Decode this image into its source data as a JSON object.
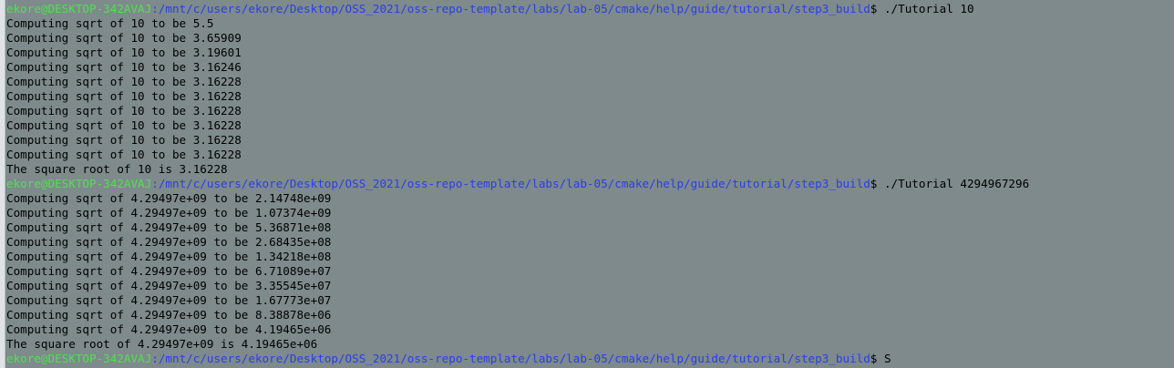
{
  "terminal": {
    "lines": [
      {
        "type": "prompt",
        "user": "ekore@DESKTOP-342AVAJ",
        "path": ":/mnt/c/users/ekore/Desktop/OSS_2021/oss-repo-template/labs/lab-05/cmake/help/guide/tutorial/step3_build",
        "sign": "$ ",
        "cmd": "./Tutorial 10"
      },
      {
        "type": "out",
        "text": "Computing sqrt of 10 to be 5.5"
      },
      {
        "type": "out",
        "text": "Computing sqrt of 10 to be 3.65909"
      },
      {
        "type": "out",
        "text": "Computing sqrt of 10 to be 3.19601"
      },
      {
        "type": "out",
        "text": "Computing sqrt of 10 to be 3.16246"
      },
      {
        "type": "out",
        "text": "Computing sqrt of 10 to be 3.16228"
      },
      {
        "type": "out",
        "text": "Computing sqrt of 10 to be 3.16228"
      },
      {
        "type": "out",
        "text": "Computing sqrt of 10 to be 3.16228"
      },
      {
        "type": "out",
        "text": "Computing sqrt of 10 to be 3.16228"
      },
      {
        "type": "out",
        "text": "Computing sqrt of 10 to be 3.16228"
      },
      {
        "type": "out",
        "text": "Computing sqrt of 10 to be 3.16228"
      },
      {
        "type": "out",
        "text": "The square root of 10 is 3.16228"
      },
      {
        "type": "prompt",
        "user": "ekore@DESKTOP-342AVAJ",
        "path": ":/mnt/c/users/ekore/Desktop/OSS_2021/oss-repo-template/labs/lab-05/cmake/help/guide/tutorial/step3_build",
        "sign": "$ ",
        "cmd": "./Tutorial 4294967296"
      },
      {
        "type": "out",
        "text": "Computing sqrt of 4.29497e+09 to be 2.14748e+09"
      },
      {
        "type": "out",
        "text": "Computing sqrt of 4.29497e+09 to be 1.07374e+09"
      },
      {
        "type": "out",
        "text": "Computing sqrt of 4.29497e+09 to be 5.36871e+08"
      },
      {
        "type": "out",
        "text": "Computing sqrt of 4.29497e+09 to be 2.68435e+08"
      },
      {
        "type": "out",
        "text": "Computing sqrt of 4.29497e+09 to be 1.34218e+08"
      },
      {
        "type": "out",
        "text": "Computing sqrt of 4.29497e+09 to be 6.71089e+07"
      },
      {
        "type": "out",
        "text": "Computing sqrt of 4.29497e+09 to be 3.35545e+07"
      },
      {
        "type": "out",
        "text": "Computing sqrt of 4.29497e+09 to be 1.67773e+07"
      },
      {
        "type": "out",
        "text": "Computing sqrt of 4.29497e+09 to be 8.38878e+06"
      },
      {
        "type": "out",
        "text": "Computing sqrt of 4.29497e+09 to be 4.19465e+06"
      },
      {
        "type": "out",
        "text": "The square root of 4.29497e+09 is 4.19465e+06"
      },
      {
        "type": "prompt",
        "user": "ekore@DESKTOP-342AVAJ",
        "path": ":/mnt/c/users/ekore/Desktop/OSS_2021/oss-repo-template/labs/lab-05/cmake/help/guide/tutorial/step3_build",
        "sign": "$ ",
        "cmd": "S"
      }
    ],
    "colors": {
      "background": "#7e8a8c",
      "user": "#4fe24f",
      "path": "#2a3ee8",
      "text": "#000000"
    }
  }
}
